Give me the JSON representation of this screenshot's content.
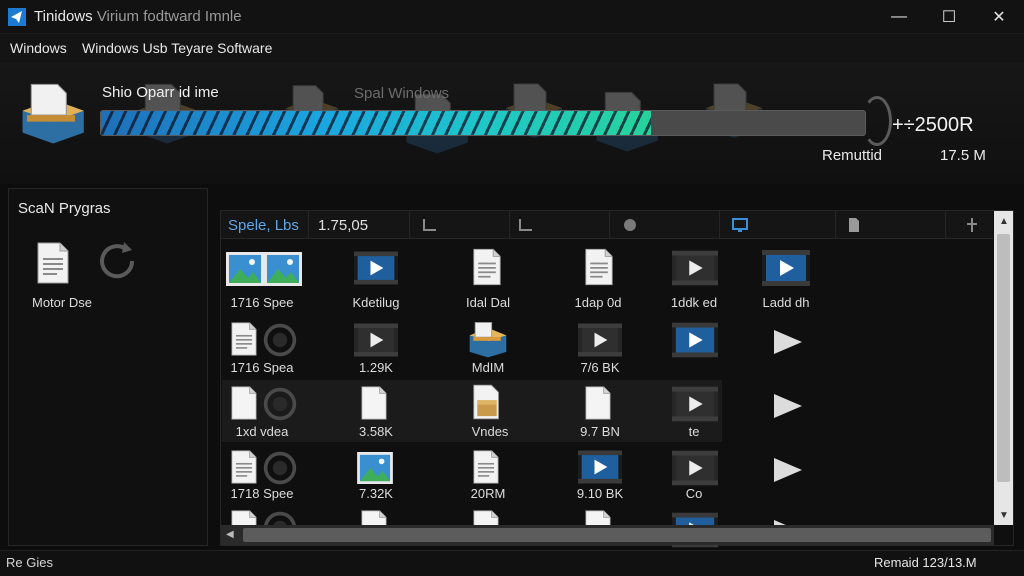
{
  "window": {
    "title": "Tinidows",
    "title_rest": "Virium fodtward",
    "title_dim": "Imnle",
    "controls": {
      "minimize": "—",
      "maximize": "☐",
      "close": "✕"
    }
  },
  "menu": [
    "Windows",
    "Windows Usb Teyare Software"
  ],
  "banner": {
    "title": "Shio Oparr id ime",
    "subtitle": "Spal Windows",
    "progress": 0.72,
    "total": "+÷2500R",
    "remaining_label": "Remuttid",
    "remaining_value": "17.5 M"
  },
  "left_panel": {
    "title": "ScaN Prygras",
    "item_label": "Motor Dse"
  },
  "grid": {
    "header_name": "Spele, Lbs",
    "header_size": "1.75,05",
    "rows": [
      [
        "1716 Spee",
        "Kdetilug",
        "Idal Dal",
        "1dap 0d",
        "1ddk ed",
        "Ladd dh"
      ],
      [
        "1716 Spea",
        "1.29K",
        "MdIM",
        "7/6 BK",
        "",
        ""
      ],
      [
        "1xd vdea",
        "3.58K",
        "Vndes",
        "9.7 BN",
        "te",
        ""
      ],
      [
        "1718 Spee",
        "7.32K",
        "20RM",
        "9.10 BK",
        "Co",
        ""
      ]
    ]
  },
  "status": {
    "left": "Re Gies",
    "right": "Remaid 123/13.M"
  },
  "colors": {
    "accent": "#5fa7e6",
    "progress_start": "#1f6fb8",
    "progress_end": "#27d39a",
    "video_blue": "#1f5f9e"
  }
}
